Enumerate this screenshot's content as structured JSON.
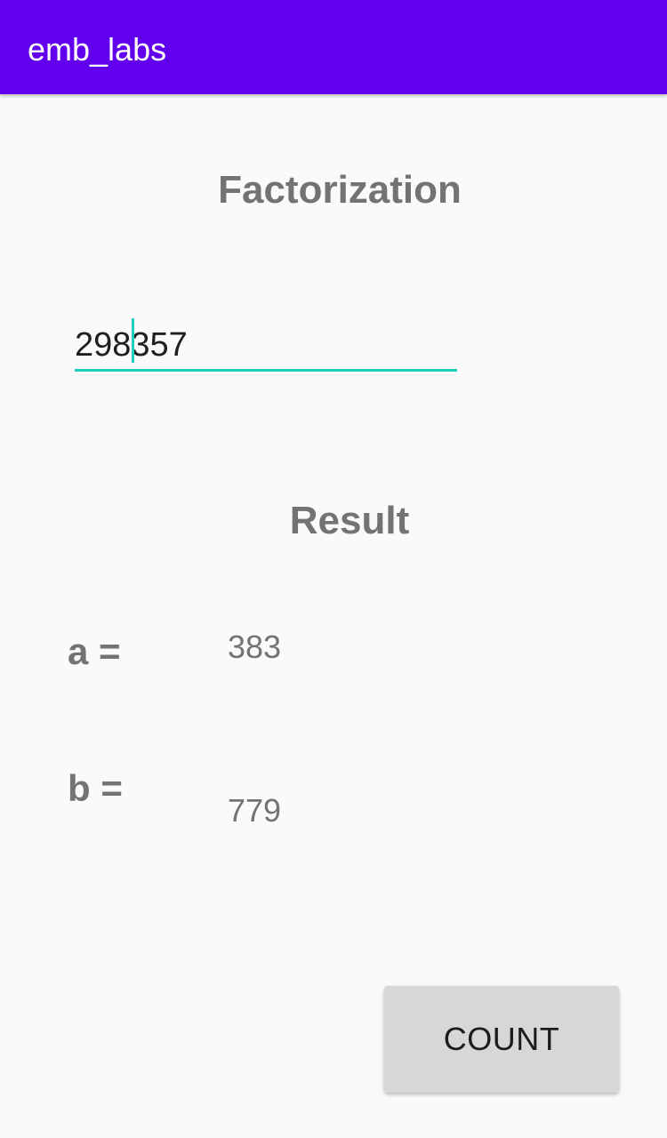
{
  "app_bar": {
    "title": "emb_labs"
  },
  "main": {
    "heading": "Factorization",
    "number_input": {
      "value": "298357"
    },
    "result_heading": "Result",
    "results": [
      {
        "label": "a =",
        "value": "383"
      },
      {
        "label": "b =",
        "value": "779"
      }
    ],
    "count_button_label": "COUNT"
  },
  "colors": {
    "app_bar": "#6200ee",
    "accent": "#1ecfc0",
    "background": "#fafafa",
    "text_gray": "#737373",
    "button_bg": "#d6d7d7"
  }
}
